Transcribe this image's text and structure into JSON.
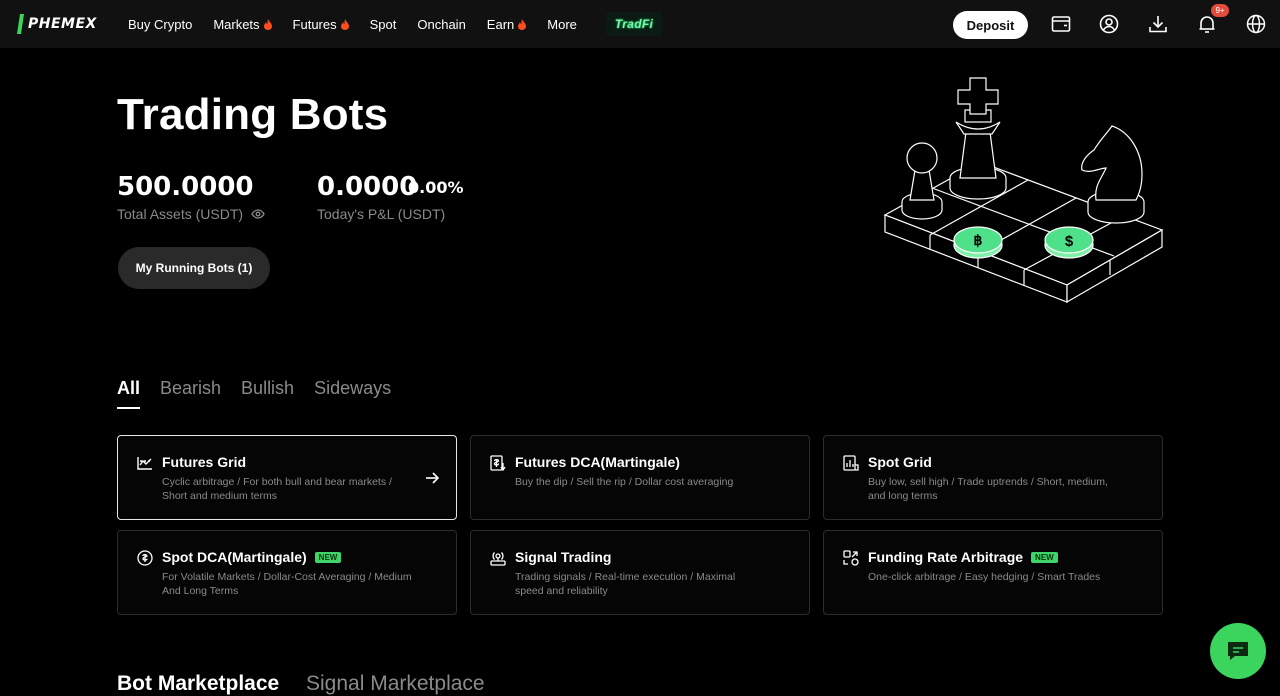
{
  "brand": {
    "name": "PHEMEX",
    "accent": "#3bd45d"
  },
  "nav": {
    "items": [
      {
        "label": "Buy Crypto",
        "hot": false
      },
      {
        "label": "Markets",
        "hot": true
      },
      {
        "label": "Futures",
        "hot": true
      },
      {
        "label": "Spot",
        "hot": false
      },
      {
        "label": "Onchain",
        "hot": false
      },
      {
        "label": "Earn",
        "hot": true
      },
      {
        "label": "More",
        "hot": false
      }
    ],
    "tradfi": "TradFi",
    "deposit": "Deposit",
    "notifications_badge": "9+",
    "icons": [
      "wallet-icon",
      "account-icon",
      "download-icon",
      "bell-icon",
      "globe-icon"
    ]
  },
  "hero": {
    "title": "Trading Bots",
    "total_assets": {
      "value": "500.0000",
      "label": "Total Assets (USDT)"
    },
    "pnl": {
      "value": "0.0000",
      "percent": "0.00%",
      "label": "Today's P&L (USDT)"
    },
    "running_bots": "My Running Bots (1)"
  },
  "tabs": [
    "All",
    "Bearish",
    "Bullish",
    "Sideways"
  ],
  "cards": [
    {
      "title": "Futures Grid",
      "desc": "Cyclic arbitrage / For both bull and bear markets / Short and medium terms",
      "new": false,
      "icon": "grid-chart-icon"
    },
    {
      "title": "Futures DCA(Martingale)",
      "desc": "Buy the dip / Sell the rip / Dollar cost averaging",
      "new": false,
      "icon": "dca-icon"
    },
    {
      "title": "Spot Grid",
      "desc": "Buy low, sell high / Trade uptrends / Short, medium, and long terms",
      "new": false,
      "icon": "spot-grid-icon"
    },
    {
      "title": "Spot DCA(Martingale)",
      "desc": "For Volatile Markets / Dollar-Cost Averaging / Medium And Long Terms",
      "new": true,
      "icon": "coin-icon"
    },
    {
      "title": "Signal Trading",
      "desc": "Trading signals / Real-time execution / Maximal speed and reliability",
      "new": false,
      "icon": "signal-icon"
    },
    {
      "title": "Funding Rate Arbitrage",
      "desc": "One-click arbitrage / Easy hedging / Smart Trades",
      "new": true,
      "icon": "arbitrage-icon"
    }
  ],
  "new_badge": "NEW",
  "marketplace": {
    "tabs": [
      "Bot Marketplace",
      "Signal Marketplace"
    ]
  }
}
